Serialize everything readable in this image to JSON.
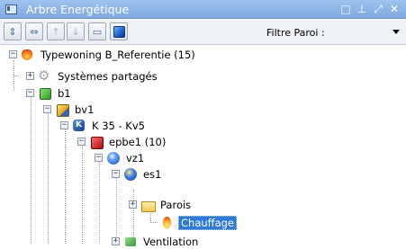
{
  "window": {
    "title": "Arbre Energétique",
    "controls": [
      "□",
      "⊥",
      "⤢",
      "✕"
    ]
  },
  "toolbar": {
    "buttons": [
      {
        "icon": "expand-all-icon",
        "glyph": "⇕",
        "enabled": true
      },
      {
        "icon": "collapse-all-icon",
        "glyph": "⇔",
        "enabled": true
      },
      {
        "icon": "move-up-icon",
        "glyph": "↑",
        "enabled": false
      },
      {
        "icon": "move-down-icon",
        "glyph": "↓",
        "enabled": false
      },
      {
        "icon": "rename-icon",
        "glyph": "▭",
        "enabled": true
      },
      {
        "icon": "blue-cube-icon",
        "glyph": "",
        "enabled": true
      }
    ],
    "filter_label": "Filtre Paroi :",
    "filter_value": ""
  },
  "tree": {
    "nodes": [
      {
        "label": "Typewoning B_Referentie (15)",
        "icon": "fire-icon",
        "expander": "−",
        "depth": 0
      },
      {
        "label": "Systèmes partagés",
        "icon": "gear-icon",
        "expander": "+",
        "depth": 1
      },
      {
        "label": "b1",
        "icon": "green-cube-icon",
        "expander": "−",
        "depth": 1
      },
      {
        "label": "bv1",
        "icon": "gold-cube-icon",
        "expander": "−",
        "depth": 2
      },
      {
        "label": "K 35 - Kv5",
        "icon": "k-cube-icon",
        "expander": "−",
        "depth": 3
      },
      {
        "label": "epbe1 (10)",
        "icon": "red-cube-icon",
        "expander": "−",
        "depth": 4
      },
      {
        "label": "vz1",
        "icon": "blue-sphere-icon",
        "expander": "−",
        "depth": 5
      },
      {
        "label": "es1",
        "icon": "energy-sector-icon",
        "expander": "−",
        "depth": 6
      },
      {
        "label": "Parois",
        "icon": "folder-icon",
        "expander": "+",
        "depth": 7
      },
      {
        "label": "Chauffage",
        "icon": "flame-icon",
        "expander": "",
        "depth": 7,
        "selected": true
      },
      {
        "label": "Ventilation",
        "icon": "ventilation-icon",
        "expander": "+",
        "depth": 6
      }
    ]
  },
  "colors": {
    "titlebar": "#8db6ea",
    "selection": "#2f7ad8"
  }
}
